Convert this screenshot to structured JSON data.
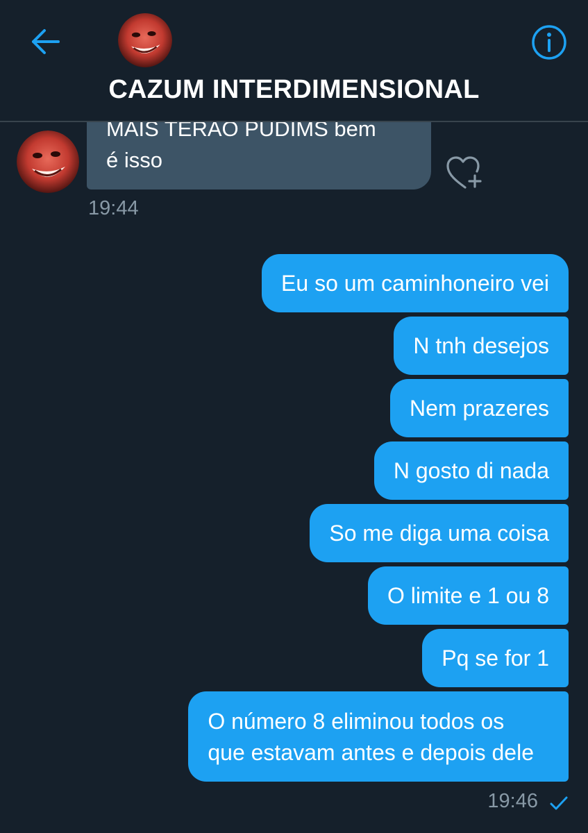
{
  "header": {
    "title": "CAZUM INTERDIMENSIONAL",
    "back_icon": "arrow-left-icon",
    "info_icon": "info-icon",
    "accent_color": "#1da1f2"
  },
  "incoming": {
    "lines": [
      "MAIS TERÃO PUDIMS bem",
      "é isso"
    ],
    "time": "19:44",
    "reaction_icon": "heart-plus-icon"
  },
  "outgoing": {
    "messages": [
      "Eu so um caminhoneiro vei",
      "N tnh desejos",
      "Nem prazeres",
      "N gosto di nada",
      "So me diga uma coisa",
      "O limite e 1 ou 8",
      "Pq se for 1"
    ],
    "last_message_lines": [
      "O número 8 eliminou todos os",
      "que estavam antes e depois dele"
    ],
    "time": "19:46",
    "status_icon": "check-icon"
  },
  "colors": {
    "background": "#15202b",
    "incoming_bubble": "#3d5466",
    "outgoing_bubble": "#1da1f2",
    "muted_text": "#8899a6"
  }
}
